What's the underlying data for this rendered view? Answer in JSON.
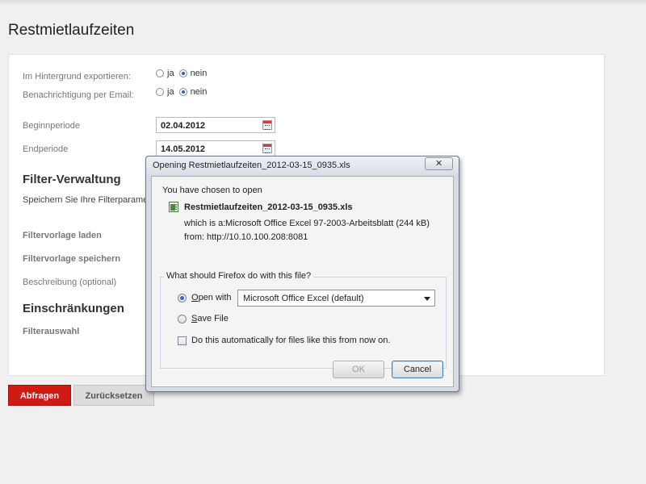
{
  "page": {
    "title": "Restmietlaufzeiten"
  },
  "form": {
    "export_bg_label": "Im Hintergrund exportieren:",
    "notify_email_label": "Benachrichtigung per Email:",
    "radio_yes": "ja",
    "radio_no": "nein",
    "export_bg_value": "nein",
    "notify_email_value": "nein",
    "begin_period_label": "Beginnperiode",
    "begin_period_value": "02.04.2012",
    "end_period_label": "Endperiode",
    "end_period_value": "14.05.2012",
    "filter_section_title": "Filter-Verwaltung",
    "filter_section_desc": "Speichern Sie Ihre Filterparameter",
    "load_template_label": "Filtervorlage laden",
    "save_template_label": "Filtervorlage speichern",
    "description_label": "Beschreibung (optional)",
    "restrictions_title": "Einschränkungen",
    "filter_selection_label": "Filterauswahl"
  },
  "actions": {
    "query_label": "Abfragen",
    "reset_label": "Zurücksetzen"
  },
  "dialog": {
    "title": "Opening Restmietlaufzeiten_2012-03-15_0935.xls",
    "close_label": "✕",
    "intro": "You have chosen to open",
    "filename": "Restmietlaufzeiten_2012-03-15_0935.xls",
    "which_is_label": "which is a:",
    "which_is_value": "Microsoft Office Excel 97-2003-Arbeitsblatt (244 kB)",
    "from_label": "from:",
    "from_value": "http://10.10.100.208:8081",
    "question": "What should Firefox do with this file?",
    "open_with_label": "Open with",
    "open_with_value": "Microsoft Office Excel (default)",
    "save_file_label": "Save File",
    "auto_label": "Do this automatically for files like this from now on.",
    "selected_option": "open_with",
    "ok_label": "OK",
    "cancel_label": "Cancel"
  },
  "colors": {
    "primary_button": "#d01a14",
    "secondary_button": "#dcdcdc",
    "radio_selected": "#2a5fb5"
  }
}
